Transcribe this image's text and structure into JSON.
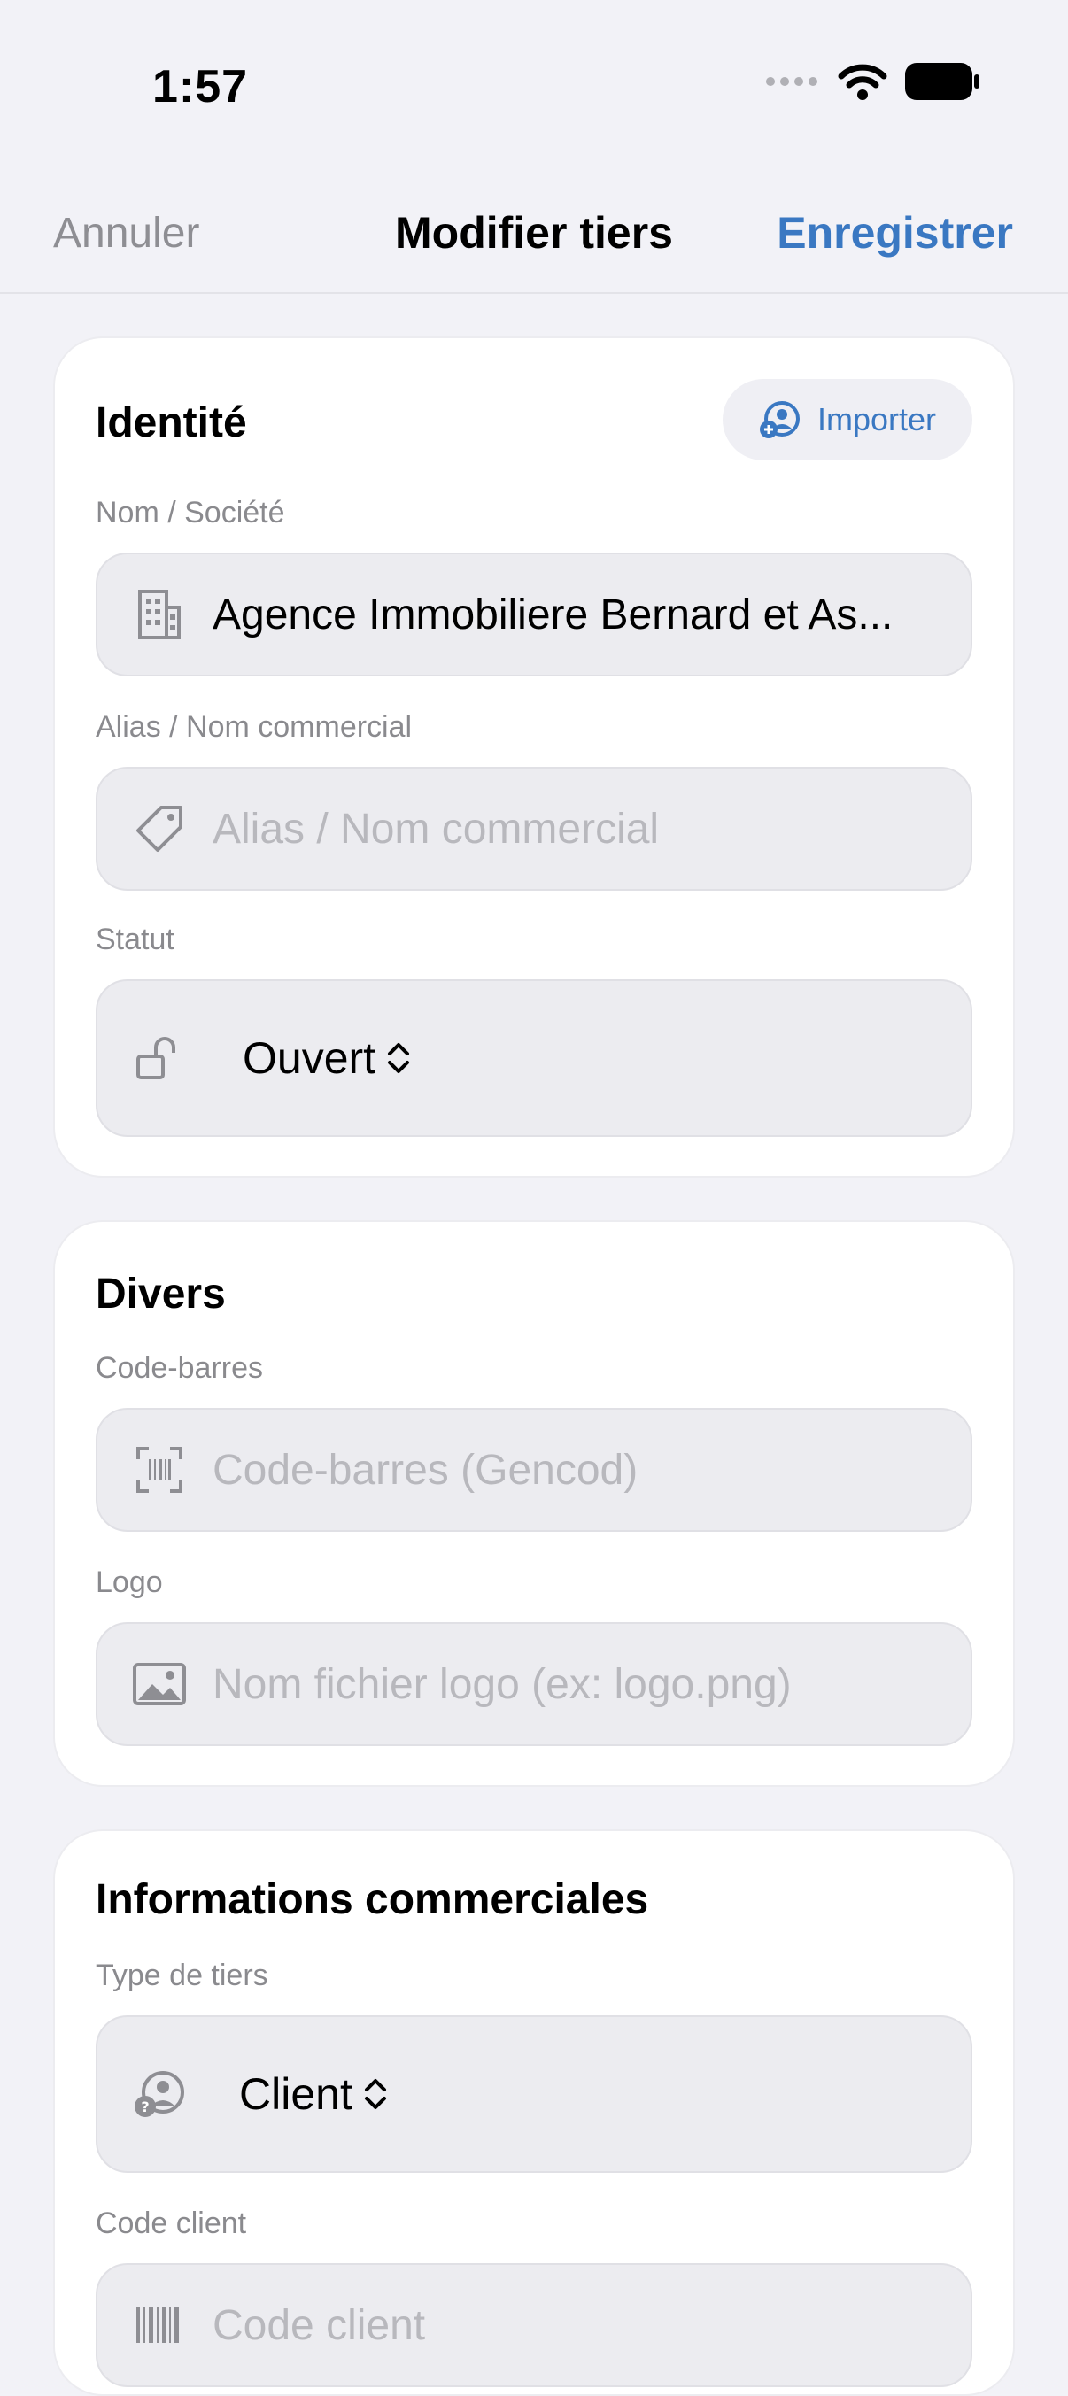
{
  "status_bar": {
    "time": "1:57"
  },
  "nav": {
    "cancel": "Annuler",
    "title": "Modifier tiers",
    "save": "Enregistrer"
  },
  "identite": {
    "title": "Identité",
    "import_label": "Importer",
    "name_label": "Nom / Société",
    "name_value": "Agence Immobiliere Bernard et As...",
    "alias_label": "Alias / Nom commercial",
    "alias_placeholder": "Alias / Nom commercial",
    "status_label": "Statut",
    "status_value": "Ouvert"
  },
  "divers": {
    "title": "Divers",
    "barcode_label": "Code-barres",
    "barcode_placeholder": "Code-barres (Gencod)",
    "logo_label": "Logo",
    "logo_placeholder": "Nom fichier logo (ex: logo.png)"
  },
  "commercial": {
    "title": "Informations commerciales",
    "type_label": "Type de tiers",
    "type_value": "Client",
    "client_code_label": "Code client",
    "client_code_placeholder": "Code client"
  },
  "colors": {
    "accent": "#3a78c2",
    "background": "#f2f2f7",
    "field": "#ececf0"
  }
}
